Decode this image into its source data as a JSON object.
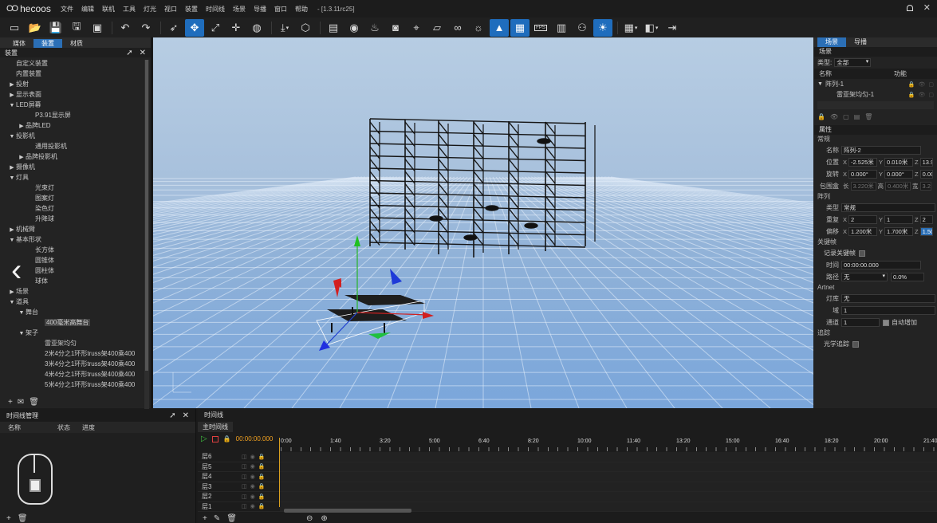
{
  "app": {
    "logo_text": "hecoos",
    "version": "- [1.3.11rc25]"
  },
  "menu": [
    "文件",
    "编辑",
    "联机",
    "工具",
    "灯光",
    "视口",
    "装置",
    "时间线",
    "场景",
    "导播",
    "窗口",
    "帮助"
  ],
  "toolbar": {
    "fps_label": "FPS",
    "icons": [
      "new-file-icon",
      "open-file-icon",
      "save-icon",
      "save-as-icon",
      "package-icon",
      "undo-icon",
      "redo-icon",
      "select-icon",
      "move-icon",
      "scale-icon",
      "transform-icon",
      "globe-icon",
      "import-icon",
      "cube-icon",
      "subtitle-icon",
      "eye-icon",
      "light-icon",
      "camera-icon",
      "focus-icon",
      "ruler-icon",
      "link-icon",
      "sun-icon",
      "rocket-icon",
      "grid-icon",
      "fps-icon",
      "device-icon",
      "group-icon",
      "weather-icon",
      "layout-icon",
      "mirror-icon",
      "exit-icon"
    ]
  },
  "left_panel": {
    "tabs": [
      "媒体",
      "装置",
      "材质"
    ],
    "active_tab": "装置",
    "header_title": "装置",
    "tree": [
      {
        "label": "自定义装置",
        "indent": 0,
        "arrow": ""
      },
      {
        "label": "内置装置",
        "indent": 0,
        "arrow": ""
      },
      {
        "label": "投射",
        "indent": 0,
        "arrow": "▶"
      },
      {
        "label": "显示表面",
        "indent": 0,
        "arrow": "▶"
      },
      {
        "label": "LED屏幕",
        "indent": 0,
        "arrow": "▼"
      },
      {
        "label": "P3.91显示屏",
        "indent": 2,
        "arrow": ""
      },
      {
        "label": "品牌LED",
        "indent": 1,
        "arrow": "▶"
      },
      {
        "label": "投影机",
        "indent": 0,
        "arrow": "▼"
      },
      {
        "label": "通用投影机",
        "indent": 2,
        "arrow": ""
      },
      {
        "label": "品牌投影机",
        "indent": 1,
        "arrow": "▶"
      },
      {
        "label": "摄像机",
        "indent": 0,
        "arrow": "▶"
      },
      {
        "label": "灯具",
        "indent": 0,
        "arrow": "▼"
      },
      {
        "label": "光束灯",
        "indent": 2,
        "arrow": ""
      },
      {
        "label": "图案灯",
        "indent": 2,
        "arrow": ""
      },
      {
        "label": "染色灯",
        "indent": 2,
        "arrow": ""
      },
      {
        "label": "升降球",
        "indent": 2,
        "arrow": ""
      },
      {
        "label": "机械臂",
        "indent": 0,
        "arrow": "▶"
      },
      {
        "label": "基本形状",
        "indent": 0,
        "arrow": "▼"
      },
      {
        "label": "长方体",
        "indent": 2,
        "arrow": ""
      },
      {
        "label": "圆锥体",
        "indent": 2,
        "arrow": ""
      },
      {
        "label": "圆柱体",
        "indent": 2,
        "arrow": ""
      },
      {
        "label": "球体",
        "indent": 2,
        "arrow": ""
      },
      {
        "label": "场景",
        "indent": 0,
        "arrow": "▶"
      },
      {
        "label": "道具",
        "indent": 0,
        "arrow": "▼"
      },
      {
        "label": "舞台",
        "indent": 1,
        "arrow": "▼"
      },
      {
        "label": "400毫米高舞台",
        "indent": 3,
        "arrow": "",
        "selected": true
      },
      {
        "label": "架子",
        "indent": 1,
        "arrow": "▼"
      },
      {
        "label": "雷亚架均匀",
        "indent": 3,
        "arrow": ""
      },
      {
        "label": "2米4分之1环形truss架400乘400",
        "indent": 3,
        "arrow": ""
      },
      {
        "label": "3米4分之1环形truss架400乘400",
        "indent": 3,
        "arrow": ""
      },
      {
        "label": "4米4分之1环形truss架400乘400",
        "indent": 3,
        "arrow": ""
      },
      {
        "label": "5米4分之1环形truss架400乘400",
        "indent": 3,
        "arrow": ""
      }
    ]
  },
  "right_panel": {
    "tabs": [
      "场景",
      "导播"
    ],
    "active_tab": "场景",
    "section_title": "场景",
    "type_label": "类型:",
    "type_value": "全部",
    "col_name": "名称",
    "col_func": "功能",
    "scene_items": [
      {
        "label": "阵列-1",
        "indent": 1
      },
      {
        "label": "雷亚架均匀-1",
        "indent": 3
      }
    ],
    "props_title": "属性",
    "group_general": "常规",
    "name_label": "名称",
    "name_value": "阵列-2",
    "pos_label": "位置",
    "pos": {
      "x": "-2.525米",
      "y": "0.010米",
      "z": "13.9"
    },
    "rot_label": "旋转",
    "rot": {
      "x": "0.000°",
      "y": "0.000°",
      "z": "0.00"
    },
    "bbox_label": "包围盒",
    "bbox": {
      "l_label": "长",
      "l": "3.220米",
      "h_label": "高",
      "h": "0.400米",
      "w_label": "宽",
      "w": "3.22"
    },
    "group_array": "阵列",
    "array_type_label": "类型",
    "array_type_value": "常规",
    "repeat_label": "重复",
    "repeat": {
      "x": "2",
      "y": "1",
      "z": "2"
    },
    "offset_label": "偏移",
    "offset": {
      "x": "1.200米",
      "y": "1.700米",
      "z": "1.500"
    },
    "group_keyframe": "关键帧",
    "record_keyframe": "记录关键帧",
    "time_label": "时间",
    "time_value": "00:00:00.000",
    "path_label": "路径",
    "path_value": "无",
    "path_pct": "0.0%",
    "group_artnet": "Artnet",
    "lib_label": "灯库",
    "lib_value": "无",
    "domain_label": "域",
    "domain_value": "1",
    "channel_label": "通道",
    "channel_value": "1",
    "auto_inc": "自动增加",
    "group_tracking": "追踪",
    "optical_tracking": "光学追踪",
    "axis_x": "X",
    "axis_y": "Y",
    "axis_z": "Z"
  },
  "timeline_mgmt": {
    "title": "时间线管理",
    "cols": [
      "名称",
      "状态",
      "进度"
    ]
  },
  "timeline": {
    "title": "时间线",
    "tab": "主时间线",
    "timecode": "00:00:00.000",
    "ruler": [
      "0:00",
      "1:40",
      "3:20",
      "5:00",
      "6:40",
      "8:20",
      "10:00",
      "11:40",
      "13:20",
      "15:00",
      "16:40",
      "18:20",
      "20:00",
      "21:40"
    ],
    "layers": [
      "层6",
      "层5",
      "层4",
      "层3",
      "层2",
      "层1"
    ]
  }
}
